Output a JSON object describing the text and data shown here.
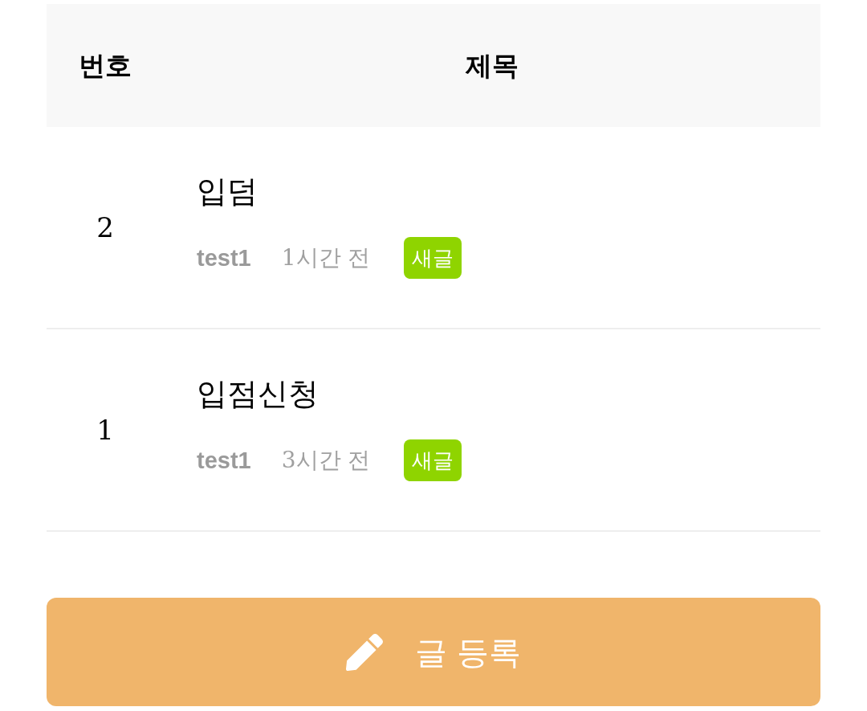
{
  "table": {
    "columns": [
      "번호",
      "제목"
    ],
    "rows": [
      {
        "number": "2",
        "title": "입덤",
        "author": "test1",
        "time": "1시간 전",
        "badge": "새글"
      },
      {
        "number": "1",
        "title": "입점신청",
        "author": "test1",
        "time": "3시간 전",
        "badge": "새글"
      }
    ]
  },
  "write_button": {
    "label": "글 등록"
  }
}
